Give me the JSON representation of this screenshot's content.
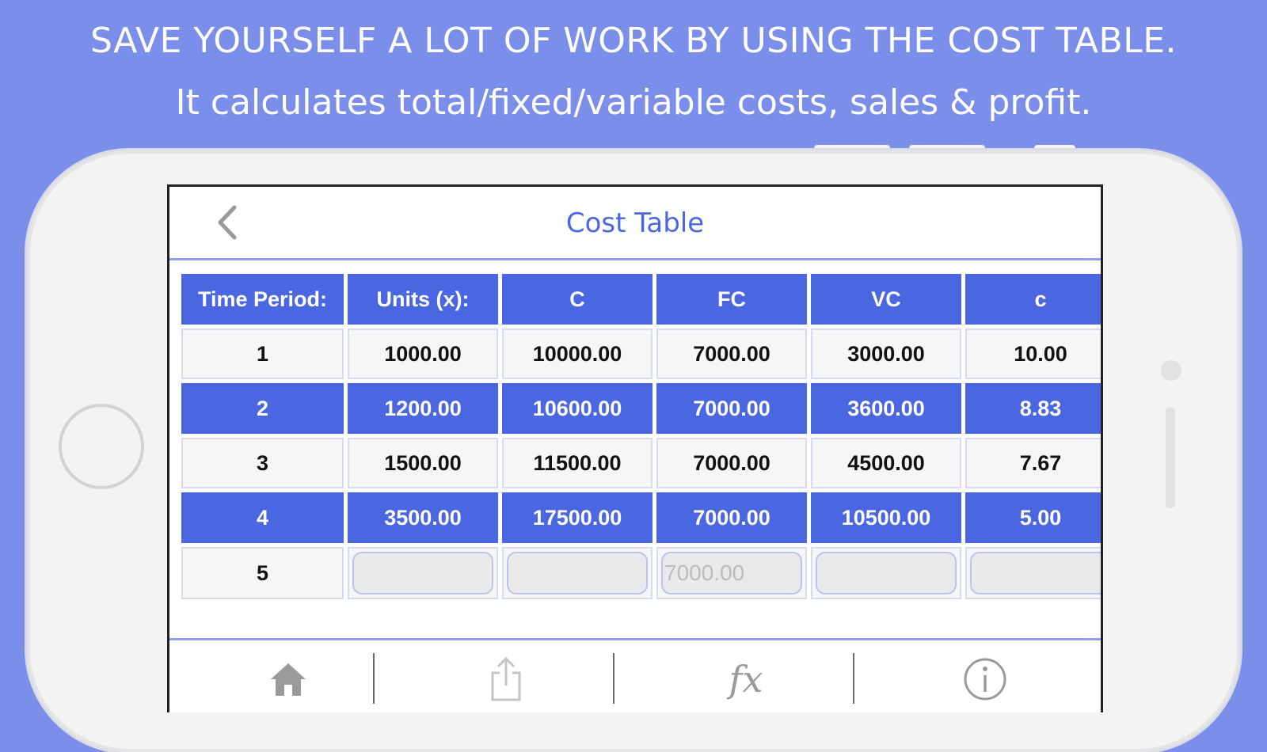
{
  "promo": {
    "headline": "SAVE YOURSELF A LOT OF WORK BY USING THE COST TABLE.",
    "subline": "It calculates total/fixed/variable costs, sales & profit."
  },
  "screen": {
    "title": "Cost Table",
    "back_icon": "chevron-left-icon",
    "accent_color": "#4a66e0"
  },
  "table": {
    "headers": [
      "Time Period:",
      "Units (x):",
      "C",
      "FC",
      "VC",
      "c"
    ],
    "rows": [
      [
        "1",
        "1000.00",
        "10000.00",
        "7000.00",
        "3000.00",
        "10.00"
      ],
      [
        "2",
        "1200.00",
        "10600.00",
        "7000.00",
        "3600.00",
        "8.83"
      ],
      [
        "3",
        "1500.00",
        "11500.00",
        "7000.00",
        "4500.00",
        "7.67"
      ],
      [
        "4",
        "3500.00",
        "17500.00",
        "7000.00",
        "10500.00",
        "5.00"
      ]
    ],
    "input_row": {
      "period": "5",
      "units_placeholder": "",
      "c_placeholder": "",
      "fc_placeholder": "7000.00",
      "vc_placeholder": "",
      "small_c_placeholder": ""
    }
  },
  "tabbar": {
    "home_icon": "home-icon",
    "share_icon": "share-icon",
    "fx_label": "fx",
    "info_icon": "info-icon"
  }
}
